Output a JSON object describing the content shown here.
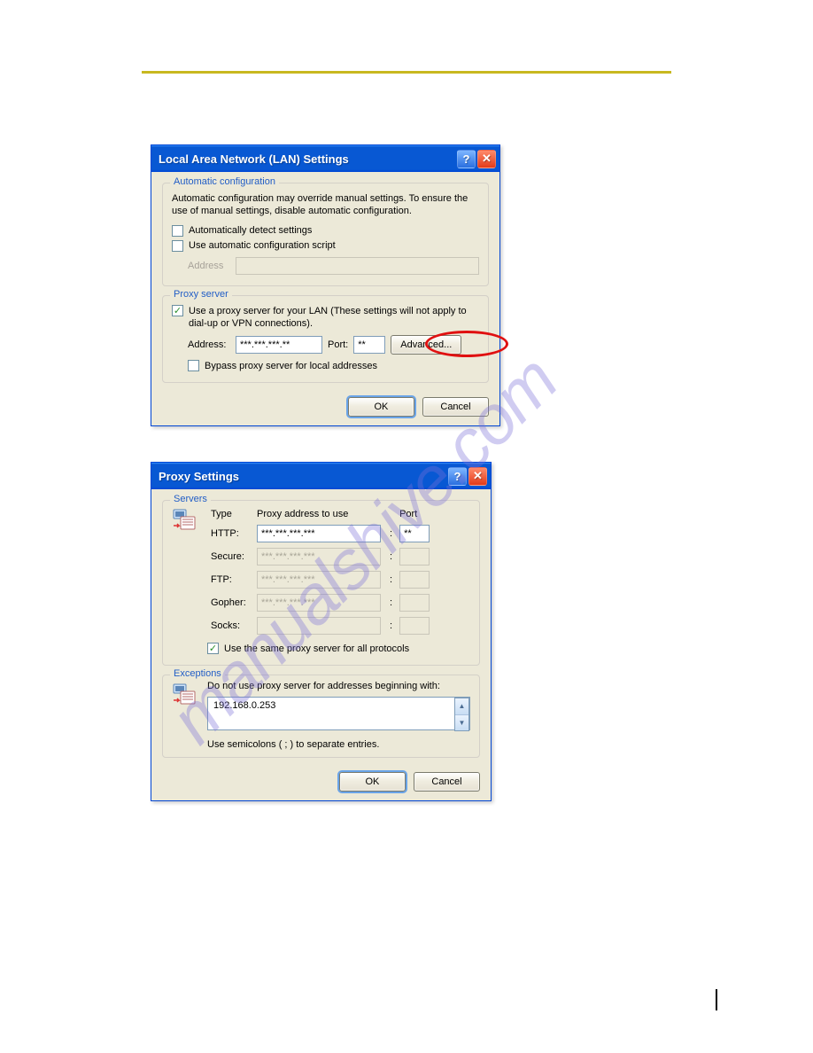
{
  "watermark_text": "manualshive.com",
  "lan_dialog": {
    "title": "Local Area Network (LAN) Settings",
    "auto_config": {
      "legend": "Automatic configuration",
      "desc": "Automatic configuration may override manual settings.  To ensure the use of manual settings, disable automatic configuration.",
      "auto_detect_label": "Automatically detect settings",
      "use_script_label": "Use automatic configuration script",
      "address_label": "Address",
      "address_value": ""
    },
    "proxy": {
      "legend": "Proxy server",
      "use_proxy_label": "Use a proxy server for your LAN (These settings will not apply to dial-up or VPN connections).",
      "address_label": "Address:",
      "address_value": "***.***.***.**",
      "port_label": "Port:",
      "port_value": "**",
      "advanced_label": "Advanced...",
      "bypass_label": "Bypass proxy server for local addresses"
    },
    "ok": "OK",
    "cancel": "Cancel"
  },
  "proxy_dialog": {
    "title": "Proxy Settings",
    "servers": {
      "legend": "Servers",
      "type_header": "Type",
      "addr_header": "Proxy address to use",
      "port_header": "Port",
      "rows": [
        {
          "type": "HTTP:",
          "addr": "***.***.***.***",
          "port": "**"
        },
        {
          "type": "Secure:",
          "addr": "***.***.***.***",
          "port": ""
        },
        {
          "type": "FTP:",
          "addr": "***.***.***.***",
          "port": ""
        },
        {
          "type": "Gopher:",
          "addr": "***.***.***.***",
          "port": ""
        },
        {
          "type": "Socks:",
          "addr": "",
          "port": ""
        }
      ],
      "same_proxy_label": "Use the same proxy server for all protocols"
    },
    "exceptions": {
      "legend": "Exceptions",
      "desc": "Do not use proxy server for addresses beginning with:",
      "value": "192.168.0.253",
      "note": "Use semicolons ( ; ) to separate entries."
    },
    "ok": "OK",
    "cancel": "Cancel"
  }
}
